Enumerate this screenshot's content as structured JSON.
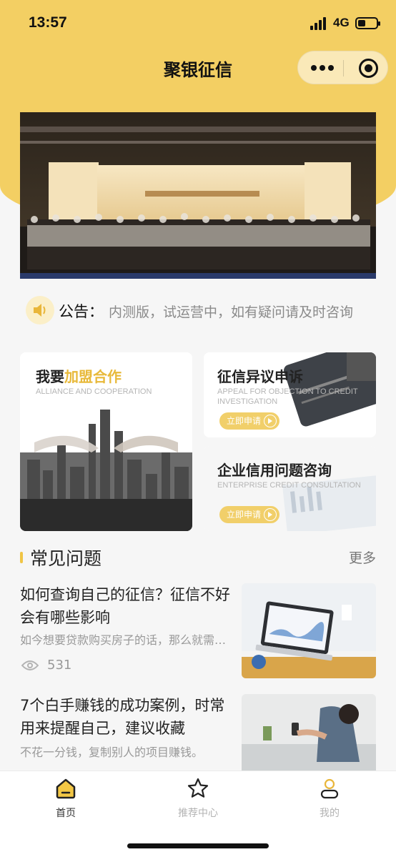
{
  "status_bar": {
    "time": "13:57",
    "network": "4G"
  },
  "header": {
    "title": "聚银征信"
  },
  "notice": {
    "label": "公告：",
    "text": "内测版，试运营中，如有疑问请及时咨询"
  },
  "cards": {
    "alliance": {
      "title_prefix": "我要",
      "title_highlight": "加盟合作",
      "subtitle": "ALLIANCE AND COOPERATION"
    },
    "appeal": {
      "title": "征信异议申诉",
      "subtitle": "APPEAL FOR OBJECTION TO CREDIT INVESTIGATION",
      "button": "立即申请"
    },
    "enterprise": {
      "title": "企业信用问题咨询",
      "subtitle": "ENTERPRISE CREDIT CONSULTATION",
      "button": "立即申请"
    }
  },
  "faq": {
    "title": "常见问题",
    "more": "更多",
    "articles": [
      {
        "title": "如何查询自己的征信？征信不好会有哪些影响",
        "excerpt": "如今想要贷款购买房子的话，那么就需要先查询征信",
        "views": "531"
      },
      {
        "title": "7个白手赚钱的成功案例，时常用来提醒自己，建议收藏",
        "excerpt": "不花一分钱，复制别人的项目赚钱。"
      }
    ]
  },
  "tabbar": {
    "home": "首页",
    "recommend": "推荐中心",
    "me": "我的"
  },
  "colors": {
    "brand_yellow": "#f3cf63",
    "accent": "#e8b93a"
  }
}
